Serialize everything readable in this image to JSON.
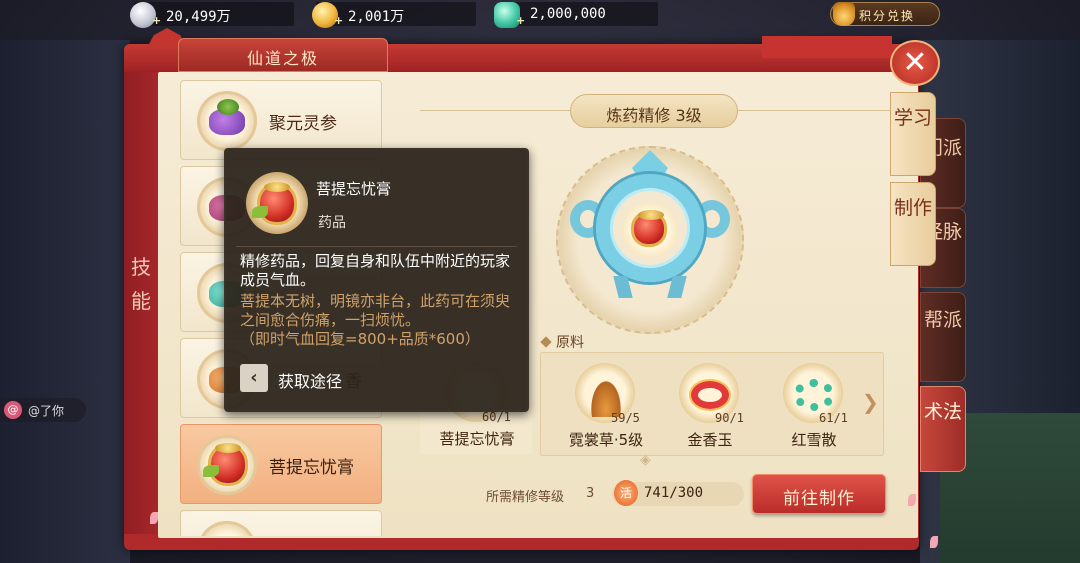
{
  "currencies": [
    {
      "icon": "silver-coin-icon",
      "value": "20,499万"
    },
    {
      "icon": "gold-coin-icon",
      "value": "2,001万"
    },
    {
      "icon": "jade-icon",
      "value": "2,000,000"
    }
  ],
  "exchange": {
    "label": "积分兑换"
  },
  "window": {
    "title": "仙道之极",
    "side_label": "技能"
  },
  "recipe_list": [
    {
      "name": "聚元灵参"
    },
    {
      "name": ""
    },
    {
      "name": ""
    },
    {
      "name": "香"
    },
    {
      "name": "菩提忘忧膏",
      "selected": true
    }
  ],
  "craft": {
    "heading": "炼药精修  3级"
  },
  "tooltip": {
    "name": "菩提忘忧膏",
    "type": "药品",
    "desc": "精修药品，回复自身和队伍中附近的玩家成员气血。",
    "lore": "菩提本无树，明镜亦非台，此药可在须臾之间愈合伤痛，一扫烦忧。",
    "effect": "（即时气血回复=800+品质*600）",
    "source_label": "获取途径"
  },
  "materials": {
    "title": "原料",
    "target": {
      "name": "菩提忘忧膏",
      "count": "60/1"
    },
    "items": [
      {
        "name": "霓裳草·5级",
        "count": "59/5"
      },
      {
        "name": "金香玉",
        "count": "90/1"
      },
      {
        "name": "红雪散",
        "count": "61/1"
      }
    ]
  },
  "bottom": {
    "req_label": "所需精修等级",
    "req_value": "3",
    "activity_icon_char": "活",
    "activity_value": "741/300",
    "go_button": "前往制作"
  },
  "right_tabs": [
    {
      "label": "学习",
      "state": "active"
    },
    {
      "label": "门派",
      "state": "dark"
    },
    {
      "label": "制作",
      "state": "active"
    },
    {
      "label": "经脉",
      "state": "dark"
    },
    {
      "label": "帮派",
      "state": "dark"
    },
    {
      "label": "术法",
      "state": "red"
    }
  ],
  "close_glyph": "✕",
  "chat": {
    "at": "@",
    "text": "@了你"
  }
}
